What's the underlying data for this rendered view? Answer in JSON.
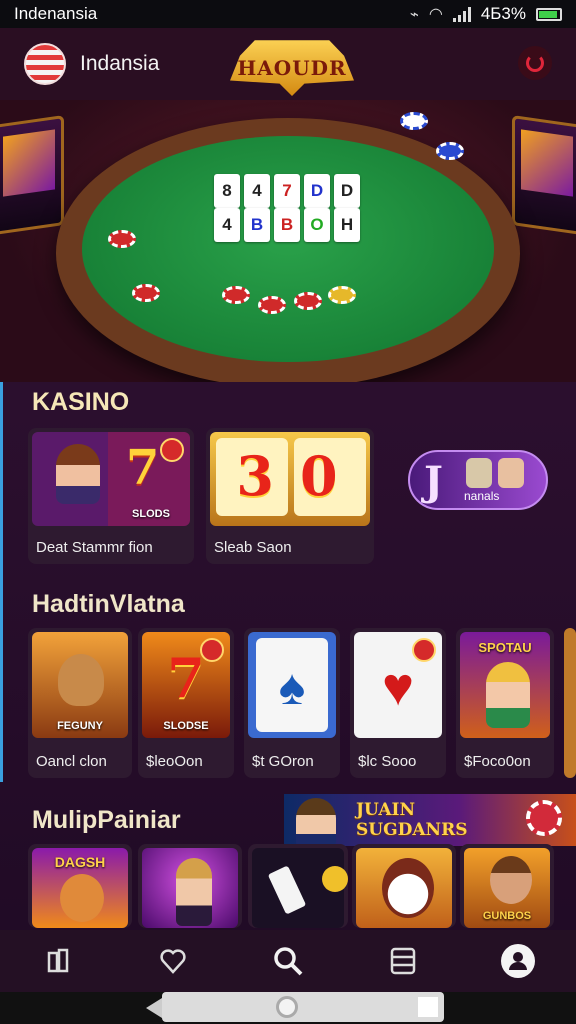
{
  "status_bar": {
    "carrier": "Indenansia",
    "battery": "4Б3%"
  },
  "header": {
    "region": "Indansia",
    "logo_text": "HAOUDR",
    "power_icon": "power-icon"
  },
  "hero": {
    "cards_top": [
      "8",
      "4",
      "7",
      "D"
    ],
    "cards_bottom": [
      "4",
      "B",
      "O",
      "H"
    ]
  },
  "sections": {
    "kasino": {
      "title": "KASINO",
      "tiles": [
        {
          "art_label": "SLODS",
          "caption": "Deat  Stammr fion"
        },
        {
          "art_label": "",
          "caption": "Sleab  Saon"
        }
      ],
      "jackpot": {
        "letter": "J",
        "label": "nanals"
      }
    },
    "hadtin": {
      "title": "HadtinVlatna",
      "tiles": [
        {
          "art_label": "FEGUNY",
          "caption": "Oancl clon"
        },
        {
          "art_label": "SLODSE",
          "caption": "$leoOon"
        },
        {
          "art_label": "",
          "caption": "$t GOron"
        },
        {
          "art_label": "",
          "caption": "$lc Sooo"
        },
        {
          "art_label": "SPOTAU",
          "caption": "$Foco0on"
        }
      ]
    },
    "multiplayer": {
      "title": "MulipPainiar",
      "promo_text": "JUAIN\nSUGDANRS",
      "tiles": [
        {
          "art_label": "DAGSH"
        },
        {
          "art_label": ""
        },
        {
          "art_label": ""
        },
        {
          "art_label": ""
        },
        {
          "art_label": "GUNBOS"
        }
      ]
    }
  },
  "bottom_nav": [
    {
      "icon": "library-icon"
    },
    {
      "icon": "heart-icon"
    },
    {
      "icon": "search-icon"
    },
    {
      "icon": "list-icon"
    },
    {
      "icon": "profile-icon"
    }
  ],
  "colors": {
    "background": "#2a0f2c",
    "accent_gold": "#f6e7b8",
    "felt": "#1f8a3c"
  }
}
